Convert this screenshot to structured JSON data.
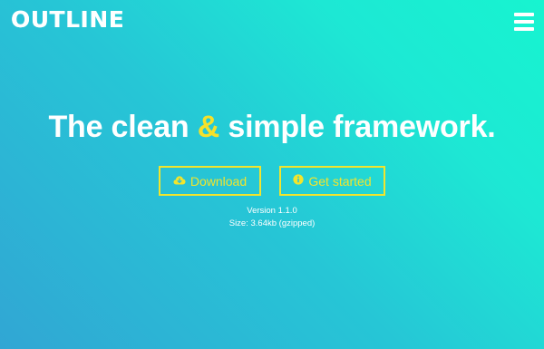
{
  "header": {
    "logo_text": "OUTLINE",
    "menu_icon": "hamburger-menu-icon"
  },
  "hero": {
    "title_part1": "The clean ",
    "title_amp": "&",
    "title_part2": " simple framework."
  },
  "actions": {
    "download": {
      "label": "Download",
      "icon": "cloud-download-icon"
    },
    "get_started": {
      "label": "Get started",
      "icon": "info-circle-icon"
    }
  },
  "meta": {
    "version": "Version 1.1.0",
    "size": "Size: 3.64kb (gzipped)"
  },
  "colors": {
    "accent": "#f2e52c",
    "gradient_start": "#31a6d4",
    "gradient_end": "#17f4d0",
    "text": "#ffffff"
  }
}
